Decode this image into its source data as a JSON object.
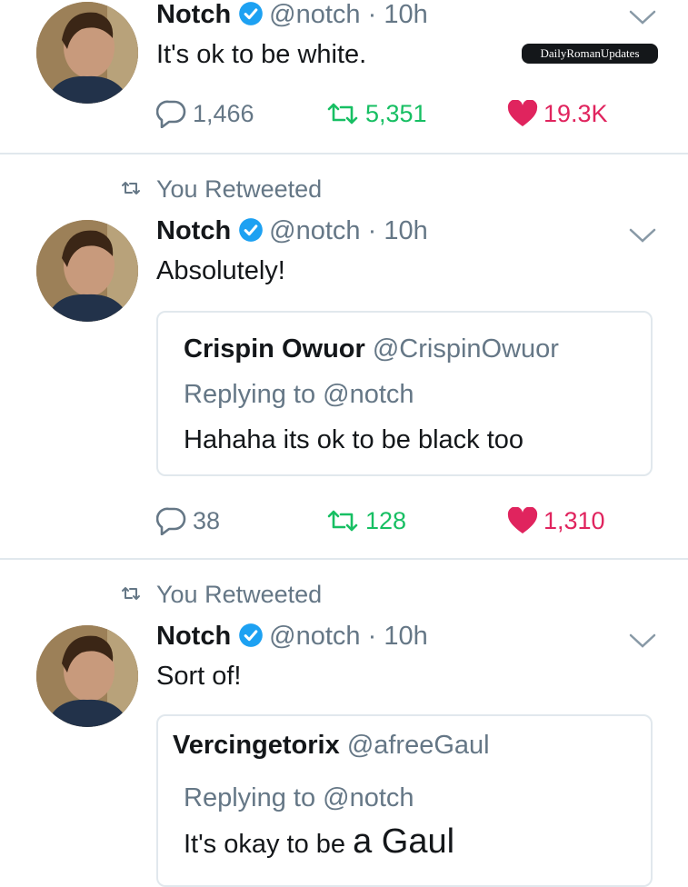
{
  "tweets": [
    {
      "name": "Notch",
      "handle": "@notch",
      "time": "· 10h",
      "text": "It's ok to be white.",
      "watermark": "DailyRomanUpdates",
      "replies": "1,466",
      "retweets": "5,351",
      "likes": "19.3K"
    },
    {
      "retweeted_label": "You Retweeted",
      "name": "Notch",
      "handle": "@notch",
      "time": "· 10h",
      "text": "Absolutely!",
      "quote": {
        "name": "Crispin Owuor",
        "handle": "@CrispinOwuor",
        "replying": "Replying to @notch",
        "text": "Hahaha its ok to be black too"
      },
      "replies": "38",
      "retweets": "128",
      "likes": "1,310"
    },
    {
      "retweeted_label": "You Retweeted",
      "name": "Notch",
      "handle": "@notch",
      "time": "· 10h",
      "text": "Sort of!",
      "quote": {
        "name": "Vercingetorix",
        "handle": "@afreeGaul",
        "replying": "Replying to @notch",
        "text_prefix": "It's okay to be",
        "text_suffix": "a Gaul"
      }
    }
  ],
  "colors": {
    "verified": "#1da1f2",
    "retweet": "#17bf63",
    "like": "#e0245e",
    "muted": "#657786",
    "divider": "#e1e8ed"
  },
  "icons": [
    "verified-badge-icon",
    "chevron-down-icon",
    "reply-icon",
    "retweet-icon",
    "heart-icon",
    "avatar"
  ]
}
